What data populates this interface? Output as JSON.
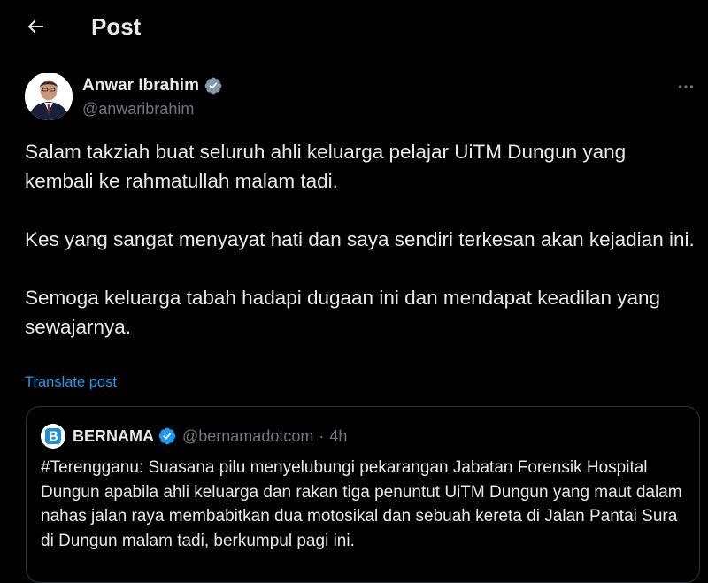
{
  "header": {
    "title": "Post"
  },
  "author": {
    "name": "Anwar Ibrahim",
    "handle": "@anwaribrahim",
    "verified": true
  },
  "tweet": {
    "paragraphs": [
      "Salam takziah buat seluruh ahli keluarga pelajar UiTM Dungun yang kembali ke rahmatullah malam tadi.",
      "Kes yang sangat menyayat hati dan saya sendiri terkesan akan kejadian ini.",
      "Semoga keluarga tabah hadapi dugaan ini dan mendapat keadilan yang sewajarnya."
    ],
    "translate_label": "Translate post"
  },
  "quote": {
    "name": "BERNAMA",
    "handle": "@bernamadotcom",
    "separator": "·",
    "time": "4h",
    "text": "#Terengganu: Suasana pilu menyelubungi pekarangan Jabatan Forensik Hospital Dungun apabila ahli keluarga dan rakan tiga penuntut UiTM Dungun yang maut dalam nahas jalan raya membabitkan dua motosikal dan sebuah kereta di Jalan Pantai Sura di Dungun malam tadi, berkumpul pagi ini."
  },
  "colors": {
    "background": "#000000",
    "text": "#e7e9ea",
    "secondary": "#71767b",
    "accent": "#1d9bf0",
    "border": "#2f3336"
  },
  "icons": {
    "back": "arrow-left-icon",
    "verified": "verified-badge-icon",
    "more": "more-horizontal-icon"
  }
}
